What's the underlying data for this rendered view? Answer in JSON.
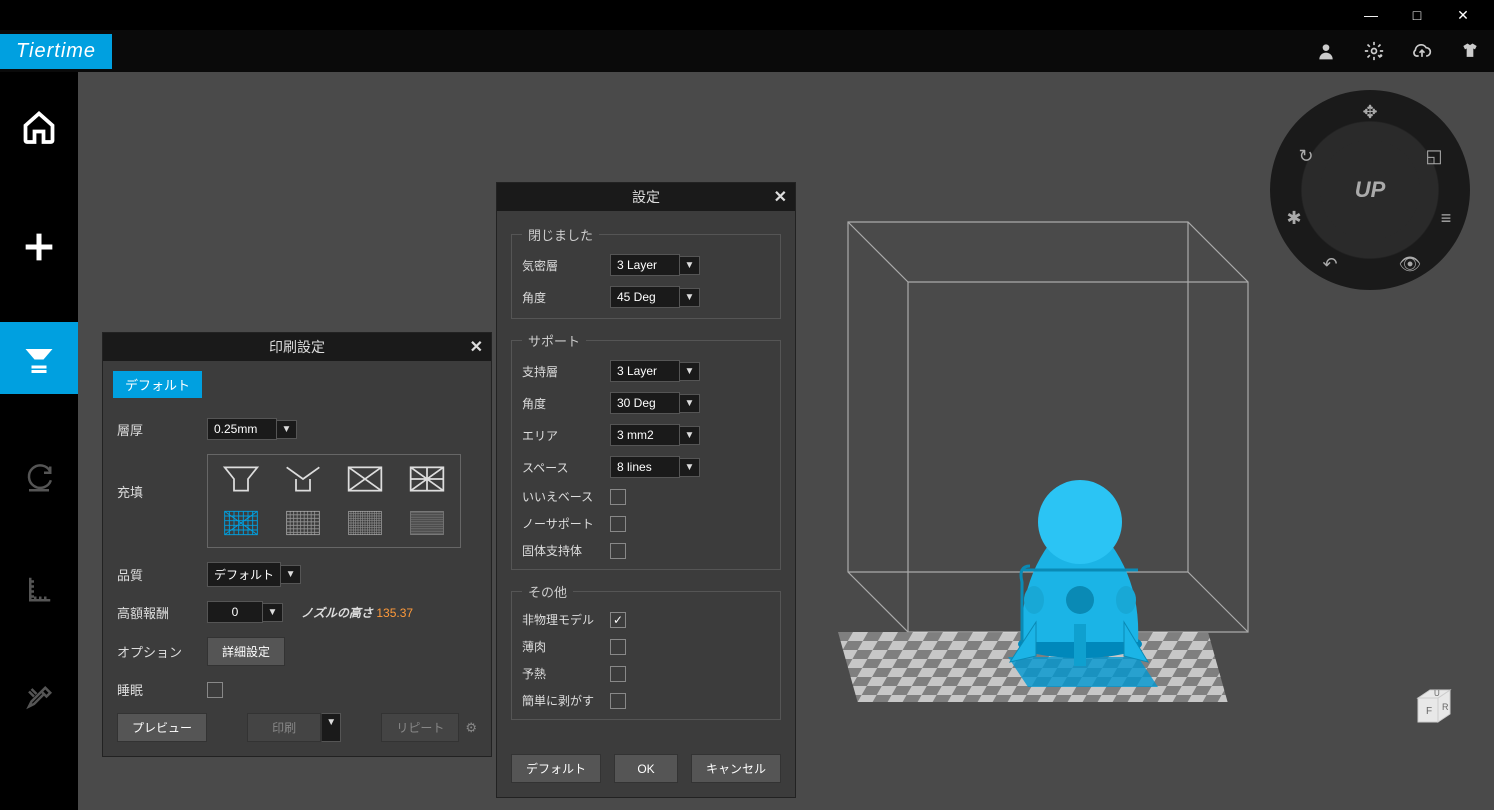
{
  "brand": "Tiertime",
  "window_controls": {
    "min": "—",
    "max": "□",
    "close": "✕"
  },
  "header_icons": {
    "user": "user-icon",
    "settings": "gear-icon",
    "cloud": "cloud-upload-icon",
    "tshirt": "tshirt-icon"
  },
  "sidebar": {
    "home": "home-icon",
    "add": "add-icon",
    "print": "print-icon",
    "refresh": "refresh-icon",
    "ruler": "ruler-icon",
    "tools": "tools-icon"
  },
  "print_panel": {
    "title": "印刷設定",
    "tab": "デフォルト",
    "layer_label": "層厚",
    "layer_value": "0.25mm",
    "infill_label": "充填",
    "quality_label": "品質",
    "quality_value": "デフォルト",
    "reward_label": "高額報酬",
    "reward_value": "0",
    "nozzle_label": "ノズルの高さ",
    "nozzle_value": "135.37",
    "option_label": "オプション",
    "option_btn": "詳細設定",
    "sleep_label": "睡眠",
    "preview_btn": "プレビュー",
    "print_btn": "印刷",
    "repeat_btn": "リピート"
  },
  "settings_panel": {
    "title": "設定",
    "closed": {
      "legend": "閉じました",
      "seal_label": "気密層",
      "seal_value": "3 Layer",
      "angle_label": "角度",
      "angle_value": "45 Deg"
    },
    "support": {
      "legend": "サポート",
      "layer_label": "支持層",
      "layer_value": "3 Layer",
      "angle_label": "角度",
      "angle_value": "30 Deg",
      "area_label": "エリア",
      "area_value": "3 mm2",
      "space_label": "スペース",
      "space_value": "8 lines",
      "nobase_label": "いいえベース",
      "nosupport_label": "ノーサポート",
      "solid_label": "固体支持体"
    },
    "other": {
      "legend": "その他",
      "nonphys_label": "非物理モデル",
      "thin_label": "薄肉",
      "preheat_label": "予熱",
      "easy_label": "簡単に剥がす"
    },
    "default_btn": "デフォルト",
    "ok_btn": "OK",
    "cancel_btn": "キャンセル"
  },
  "dial": {
    "center": "UP"
  },
  "cube": {
    "f": "F",
    "r": "R",
    "u": "U"
  }
}
